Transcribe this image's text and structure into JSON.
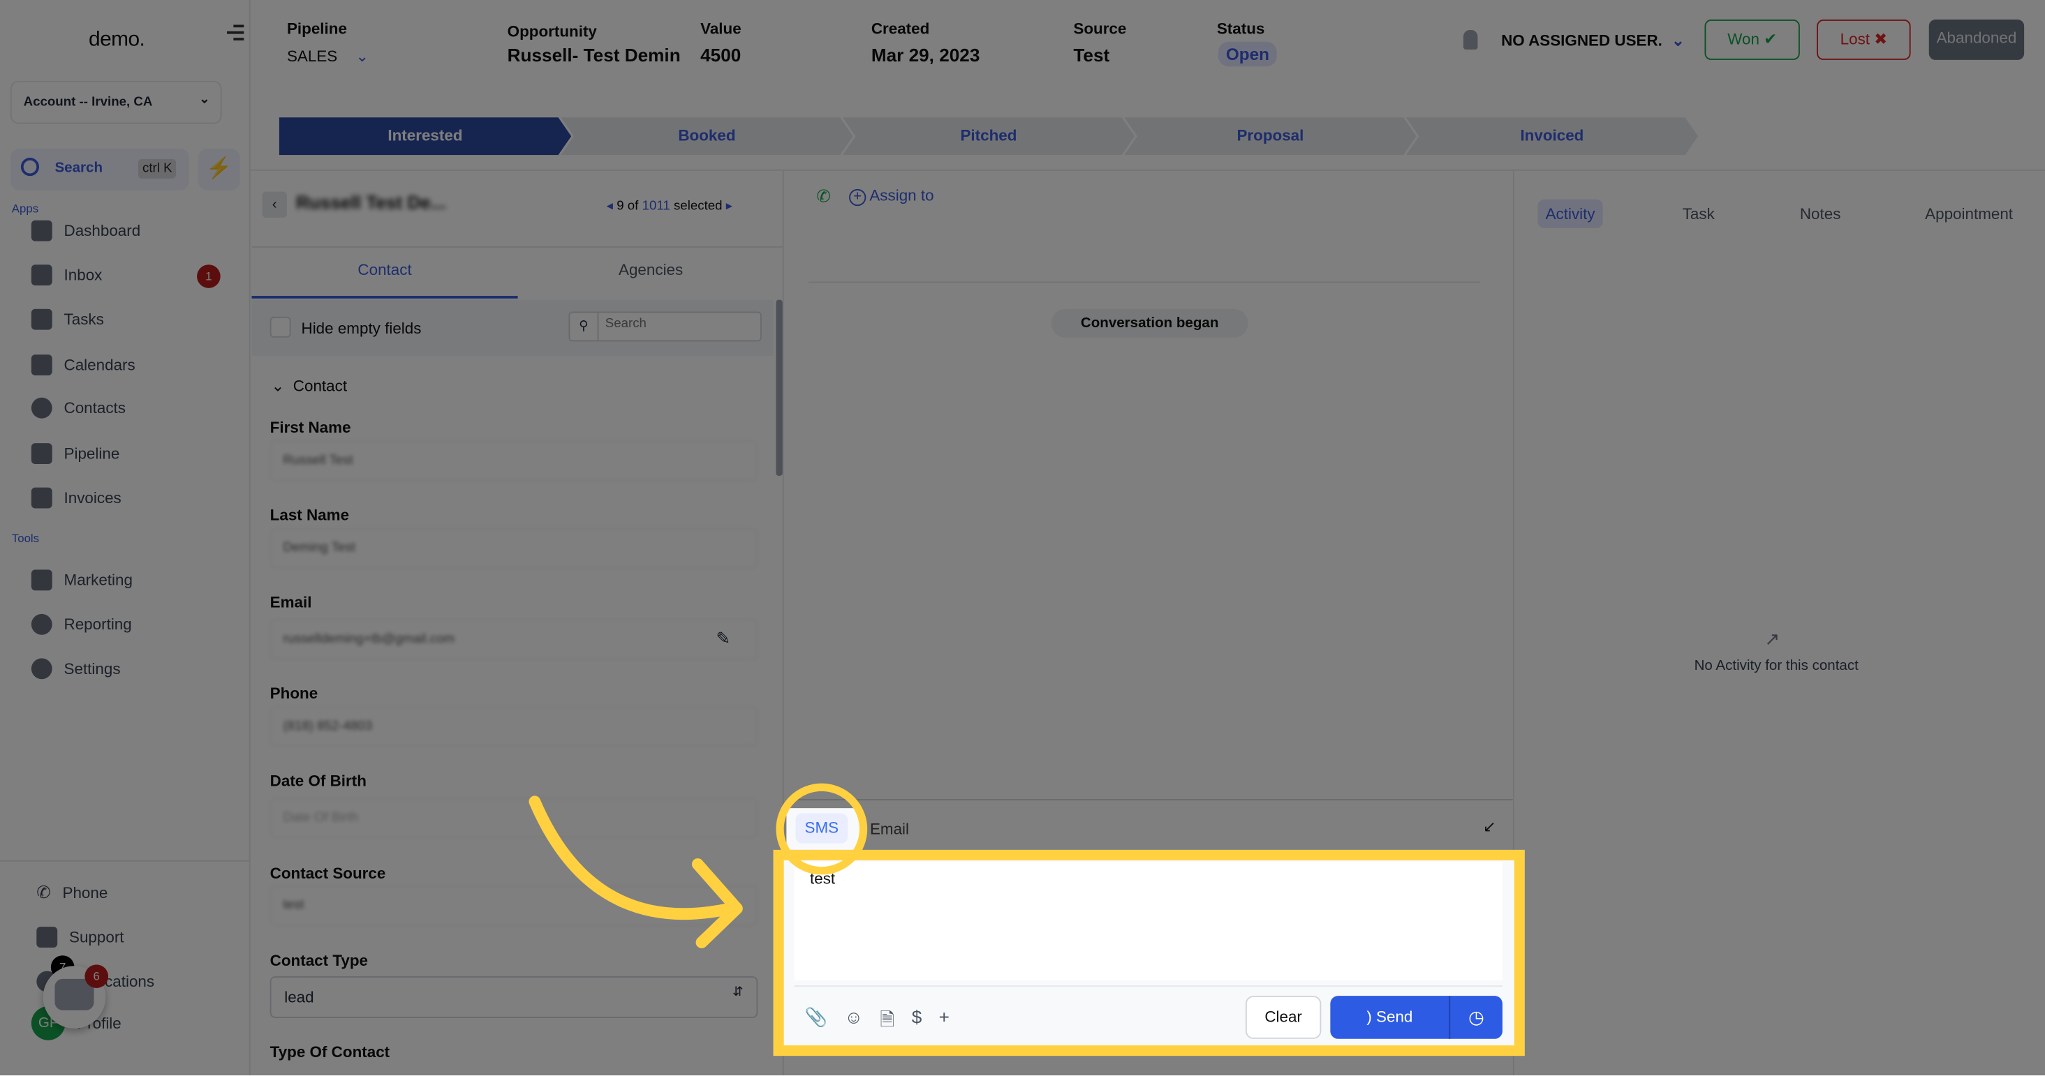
{
  "sidebar": {
    "logo": "demo.",
    "account": "Account -- Irvine, CA",
    "search_label": "Search",
    "search_shortcut": "ctrl K",
    "apps_label": "Apps",
    "tools_label": "Tools",
    "apps": [
      {
        "label": "Dashboard",
        "icon": "dashboard-icon"
      },
      {
        "label": "Inbox",
        "icon": "inbox-icon",
        "badge": "1"
      },
      {
        "label": "Tasks",
        "icon": "tasks-icon"
      },
      {
        "label": "Calendars",
        "icon": "calendar-icon"
      },
      {
        "label": "Contacts",
        "icon": "contacts-icon"
      },
      {
        "label": "Pipeline",
        "icon": "pipeline-icon"
      },
      {
        "label": "Invoices",
        "icon": "invoices-icon"
      }
    ],
    "tools": [
      {
        "label": "Marketing",
        "icon": "megaphone-icon"
      },
      {
        "label": "Reporting",
        "icon": "chart-icon"
      },
      {
        "label": "Settings",
        "icon": "gear-icon"
      }
    ],
    "bottom": [
      {
        "label": "Phone"
      },
      {
        "label": "Support"
      },
      {
        "label": "Notifications",
        "badge": "7"
      },
      {
        "label": "Profile",
        "avatar": "GF"
      }
    ],
    "chat_widget_badge": "6"
  },
  "header": {
    "pipeline_label": "Pipeline",
    "pipeline_value": "SALES",
    "opportunity_label": "Opportunity",
    "opportunity_value": "Russell- Test Demin",
    "value_label": "Value",
    "value_value": "4500",
    "created_label": "Created",
    "created_value": "Mar 29, 2023",
    "source_label": "Source",
    "source_value": "Test",
    "status_label": "Status",
    "status_value": "Open",
    "assigned_user": "NO ASSIGNED USER.",
    "won": "Won",
    "lost": "Lost",
    "abandoned": "Abandoned"
  },
  "stages": [
    {
      "label": "Interested",
      "active": true
    },
    {
      "label": "Booked"
    },
    {
      "label": "Pitched"
    },
    {
      "label": "Proposal"
    },
    {
      "label": "Invoiced"
    }
  ],
  "contact_panel": {
    "name": "Russell Test De...",
    "pager_index": "9 of",
    "pager_total": "1011",
    "pager_suffix": "selected",
    "tabs": [
      "Contact",
      "Agencies"
    ],
    "hide_empty": "Hide empty fields",
    "search_placeholder": "Search",
    "section": "Contact",
    "fields": [
      {
        "label": "First Name",
        "value": "Russell Test"
      },
      {
        "label": "Last Name",
        "value": "Deming Test"
      },
      {
        "label": "Email",
        "value": "russelldeming+tb@gmail.com"
      },
      {
        "label": "Phone",
        "value": "(818) 852-4803"
      },
      {
        "label": "Date Of Birth",
        "value": "Date Of Birth"
      },
      {
        "label": "Contact Source",
        "value": "test"
      },
      {
        "label": "Contact Type",
        "value": "lead"
      },
      {
        "label": "Type Of Contact",
        "value": ""
      }
    ]
  },
  "conversation": {
    "assign_to": "Assign to",
    "began": "Conversation began",
    "channels": [
      "SMS",
      "Email"
    ],
    "active_channel": "SMS",
    "message": "test",
    "clear": "Clear",
    "send": "Send"
  },
  "activity_panel": {
    "tabs": [
      "Activity",
      "Task",
      "Notes",
      "Appointment"
    ],
    "empty": "No Activity for this contact"
  },
  "colors": {
    "primary": "#2d5be3",
    "highlight": "#ffd140",
    "won": "#16a34a",
    "lost": "#dc2626"
  }
}
